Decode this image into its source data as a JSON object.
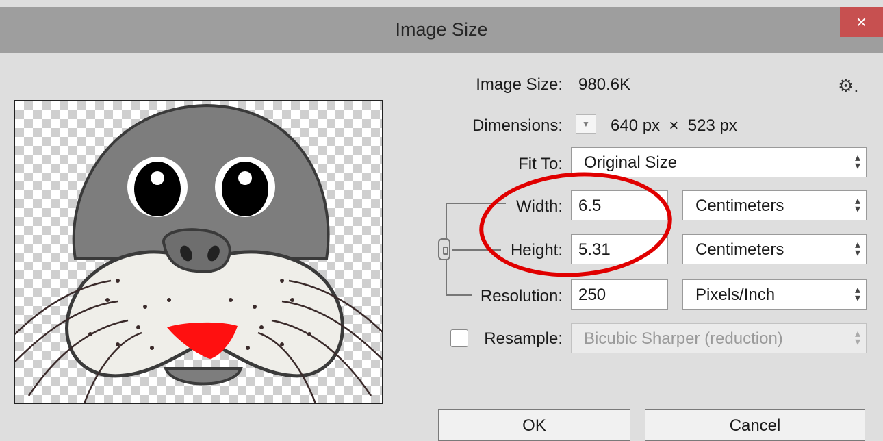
{
  "dialog": {
    "title": "Image Size",
    "close_glyph": "×"
  },
  "icons": {
    "close": "close-icon",
    "settings": "gear-icon",
    "dimensions_dropdown": "dropdown-icon",
    "constrain": "chain-link-icon"
  },
  "info": {
    "image_size_label": "Image Size:",
    "image_size_value": "980.6K",
    "dimensions_label": "Dimensions:",
    "dimensions_value": "640 px  ×  523 px",
    "gear_glyph": "⚙."
  },
  "fit_to": {
    "label": "Fit To:",
    "selected": "Original Size"
  },
  "width": {
    "label": "Width:",
    "value": "6.5",
    "unit": "Centimeters"
  },
  "height": {
    "label": "Height:",
    "value": "5.31",
    "unit": "Centimeters"
  },
  "resolution": {
    "label": "Resolution:",
    "value": "250",
    "unit": "Pixels/Inch"
  },
  "resample": {
    "label": "Resample:",
    "checked": false,
    "method": "Bicubic Sharper (reduction)"
  },
  "buttons": {
    "ok": "OK",
    "cancel": "Cancel"
  },
  "colors": {
    "annotation": "#e00000",
    "close_button": "#c75050",
    "titlebar": "#9e9e9e",
    "background": "#dedede"
  }
}
